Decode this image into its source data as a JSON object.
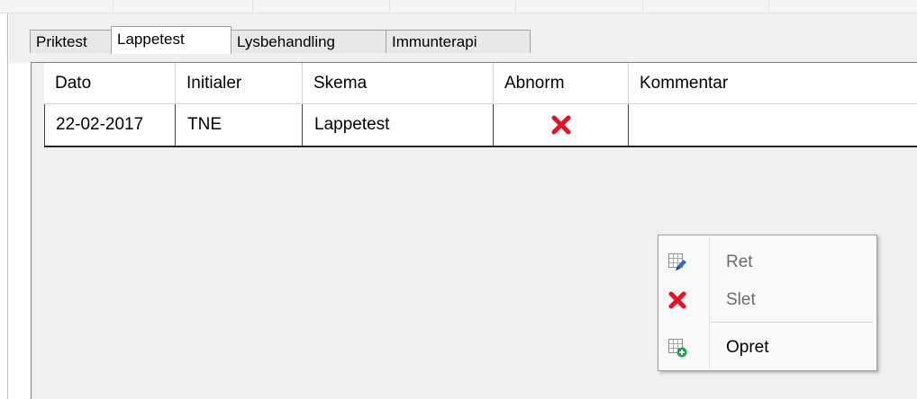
{
  "tabs": [
    {
      "label": "Priktest",
      "active": false
    },
    {
      "label": "Lappetest",
      "active": true
    },
    {
      "label": "Lysbehandling",
      "active": false
    },
    {
      "label": "Immunterapi",
      "active": false
    }
  ],
  "grid": {
    "columns": [
      "Dato",
      "Initialer",
      "Skema",
      "Abnorm",
      "Kommentar"
    ],
    "rows": [
      {
        "dato": "22-02-2017",
        "initialer": "TNE",
        "skema": "Lappetest",
        "abnorm_icon": "red-x-icon",
        "kommentar": ""
      }
    ]
  },
  "context_menu": {
    "items": [
      {
        "label": "Ret",
        "icon": "edit-table-icon",
        "enabled": false
      },
      {
        "label": "Slet",
        "icon": "delete-x-icon",
        "enabled": false
      },
      {
        "label": "Opret",
        "icon": "add-table-icon",
        "enabled": true
      }
    ]
  },
  "colors": {
    "delete_red": "#e81123",
    "add_green": "#1aa34a",
    "pencil_blue": "#2b6bd6"
  }
}
